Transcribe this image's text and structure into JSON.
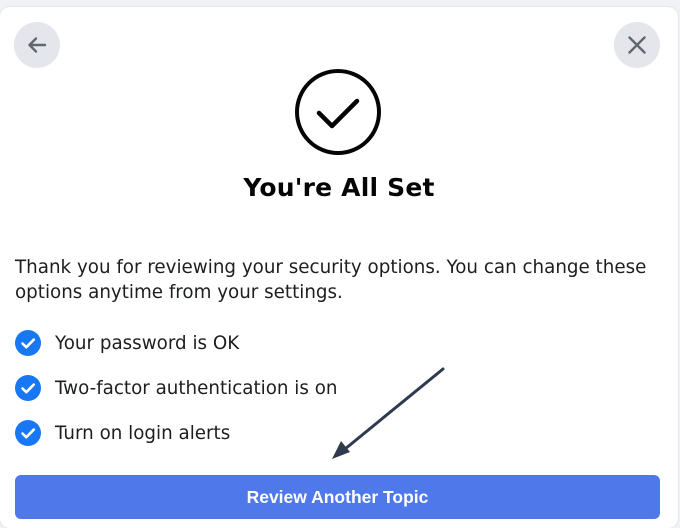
{
  "dialog": {
    "title": "You're All Set",
    "description": "Thank you for reviewing your security options. You can change these options anytime from your settings.",
    "back_icon": "arrow-left-icon",
    "close_icon": "close-icon",
    "success_icon": "checkmark-circle-icon"
  },
  "status_items": [
    {
      "label": "Your password is OK",
      "icon": "blue-check-icon"
    },
    {
      "label": "Two-factor authentication is on",
      "icon": "blue-check-icon"
    },
    {
      "label": "Turn on login alerts",
      "icon": "blue-check-icon"
    }
  ],
  "actions": {
    "primary_label": "Review Another Topic"
  },
  "colors": {
    "accent": "#4f78ea",
    "check_blue": "#1877f2",
    "icon_button_bg": "#e4e6eb",
    "annotation": "#2f3a4f"
  }
}
